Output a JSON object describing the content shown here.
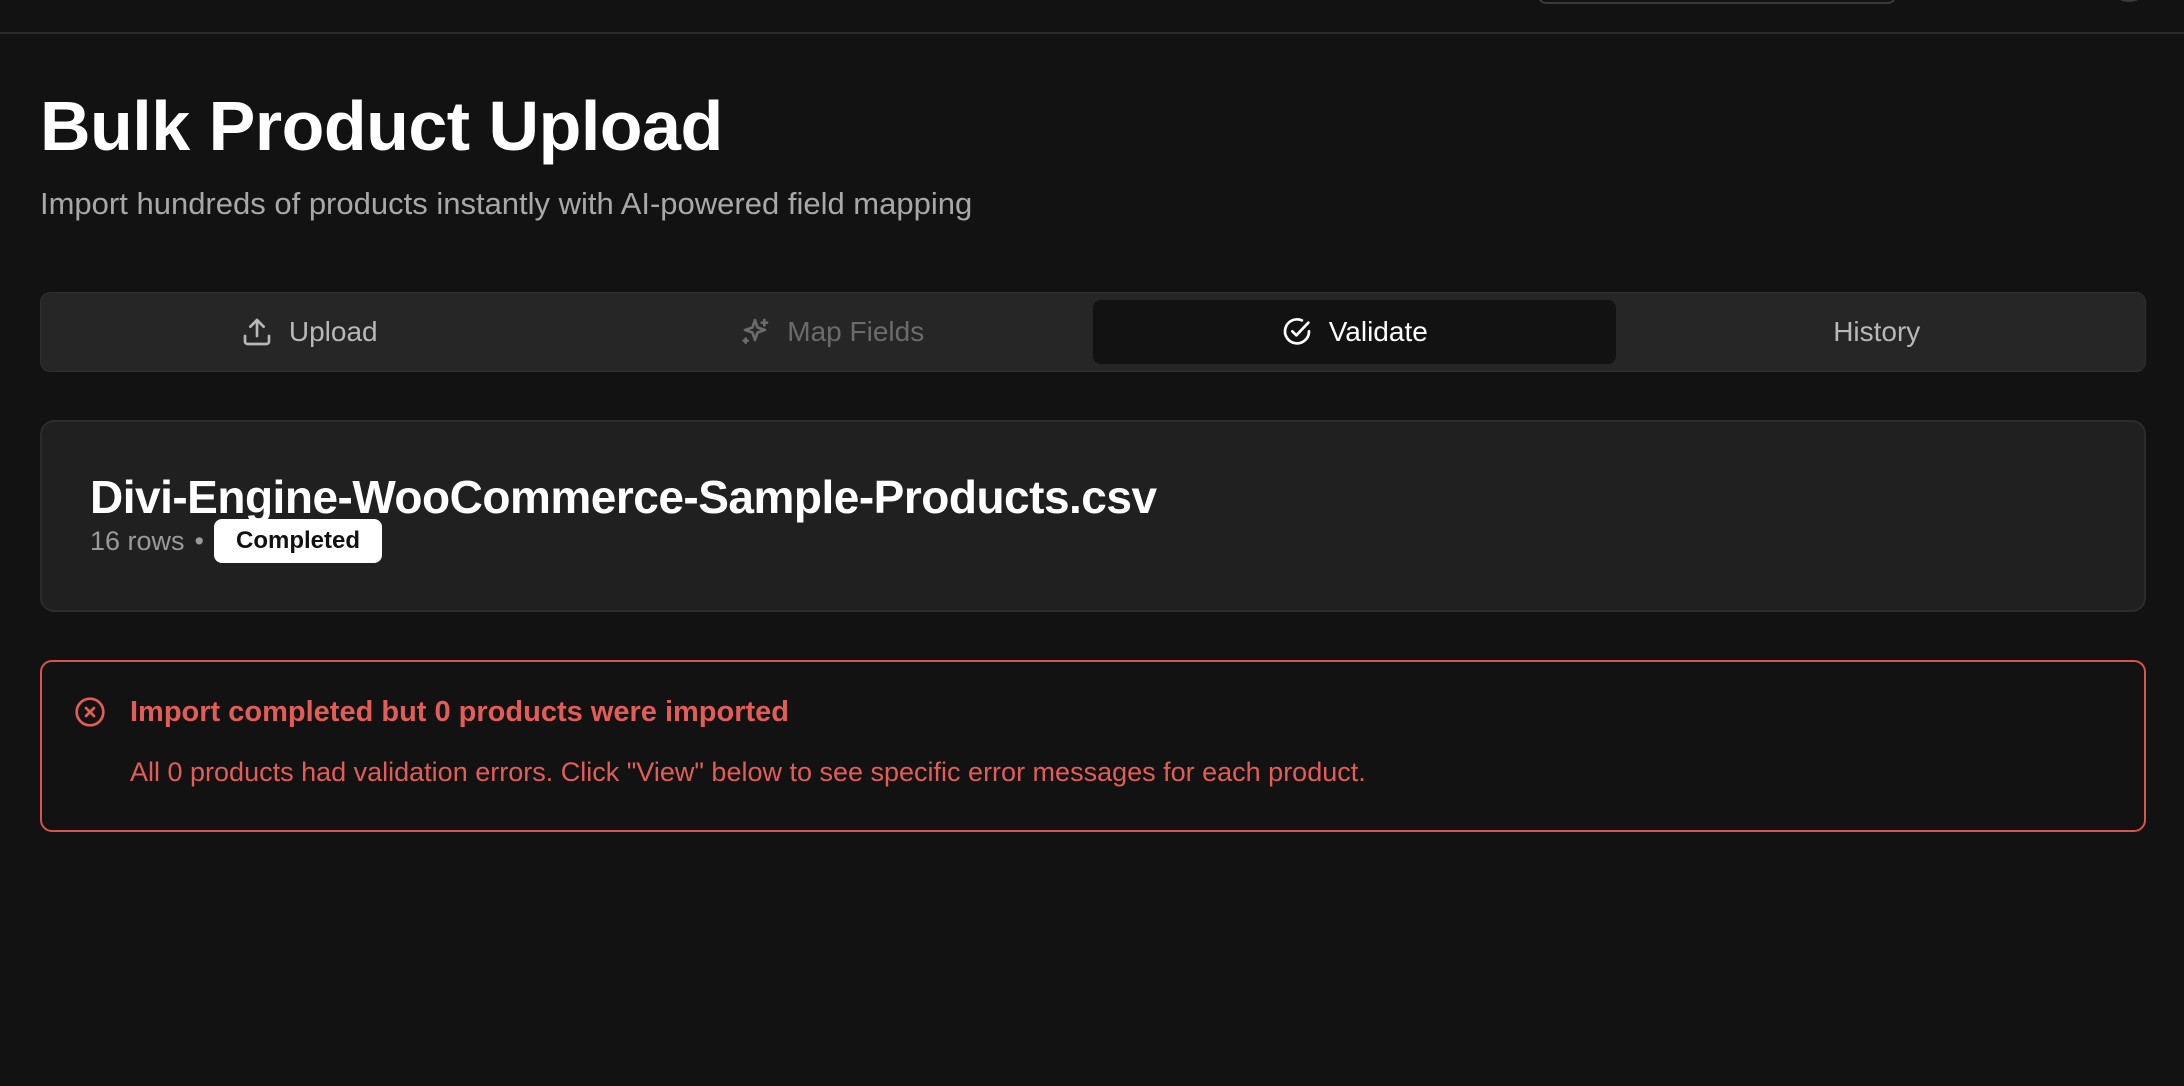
{
  "header": {
    "title": "Bulk Product Upload",
    "subtitle": "Import hundreds of products instantly with AI-powered field mapping"
  },
  "tabs": [
    {
      "label": "Upload",
      "icon": "upload-icon",
      "state": "enabled"
    },
    {
      "label": "Map Fields",
      "icon": "sparkle-icon",
      "state": "disabled"
    },
    {
      "label": "Validate",
      "icon": "check-circle-icon",
      "state": "active"
    },
    {
      "label": "History",
      "icon": "",
      "state": "enabled"
    }
  ],
  "file": {
    "name": "Divi-Engine-WooCommerce-Sample-Products.csv",
    "rows": "16 rows",
    "separator": "•",
    "status": "Completed"
  },
  "alert": {
    "icon": "x-circle-icon",
    "title": "Import completed but 0 products were imported",
    "message": "All 0 products had validation errors. Click \"View\" below to see specific error messages for each product.",
    "color": "#e35d58"
  },
  "colors": {
    "background": "#121212",
    "tab_bar": "#262626",
    "card": "#202020",
    "error": "#d9534f"
  }
}
